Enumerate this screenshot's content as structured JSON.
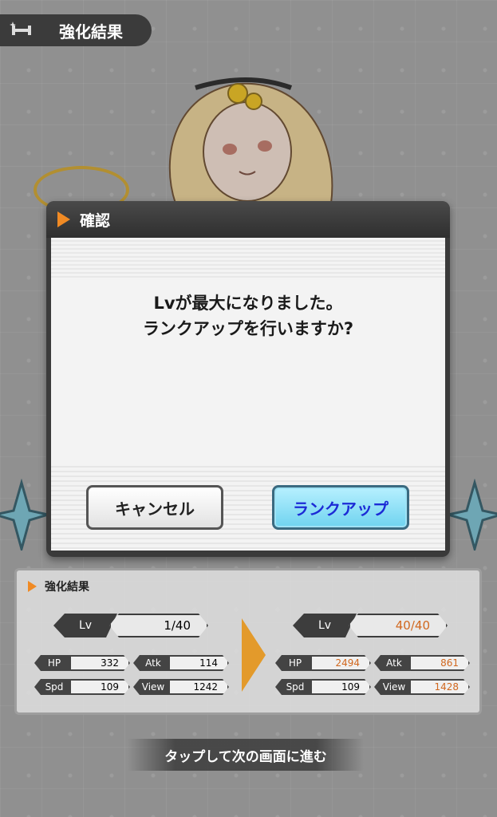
{
  "header": {
    "title": "強化結果",
    "icon": "dumbbell-sparkle-icon"
  },
  "dialog": {
    "title": "確認",
    "message_line1": "Lvが最大になりました。",
    "message_line2": "ランクアップを行いますか?",
    "cancel_label": "キャンセル",
    "rankup_label": "ランクアップ"
  },
  "panel": {
    "title": "強化結果",
    "before": {
      "lv_label": "Lv",
      "lv_value": "1/40",
      "hp_label": "HP",
      "hp": "332",
      "atk_label": "Atk",
      "atk": "114",
      "spd_label": "Spd",
      "spd": "109",
      "view_label": "View",
      "view": "1242"
    },
    "after": {
      "lv_label": "Lv",
      "lv_value": "40/40",
      "hp_label": "HP",
      "hp": "2494",
      "atk_label": "Atk",
      "atk": "861",
      "spd_label": "Spd",
      "spd": "109",
      "view_label": "View",
      "view": "1428"
    }
  },
  "footer": {
    "tap_text": "タップして次の画面に進む"
  },
  "colors": {
    "accent_orange": "#f08a24",
    "rank_button": "#6fd3ef",
    "increase_text": "#d1681f"
  }
}
